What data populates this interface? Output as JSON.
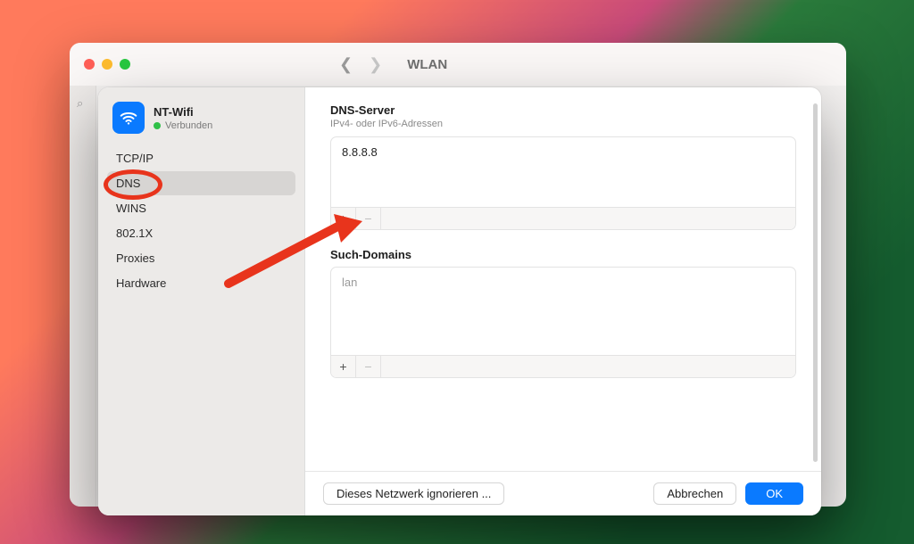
{
  "parent_window": {
    "title": "WLAN"
  },
  "network": {
    "name": "NT-Wifi",
    "status": "Verbunden"
  },
  "sidebar": {
    "items": [
      {
        "label": "TCP/IP"
      },
      {
        "label": "DNS"
      },
      {
        "label": "WINS"
      },
      {
        "label": "802.1X"
      },
      {
        "label": "Proxies"
      },
      {
        "label": "Hardware"
      }
    ],
    "selected_index": 1
  },
  "dns_section": {
    "title": "DNS-Server",
    "subtitle": "IPv4- oder IPv6-Adressen",
    "entries": [
      "8.8.8.8"
    ]
  },
  "search_domains_section": {
    "title": "Such-Domains",
    "entries": [
      "lan"
    ]
  },
  "footer": {
    "forget": "Dieses Netzwerk ignorieren ...",
    "cancel": "Abbrechen",
    "ok": "OK"
  },
  "icons": {
    "plus": "+",
    "minus": "−"
  }
}
